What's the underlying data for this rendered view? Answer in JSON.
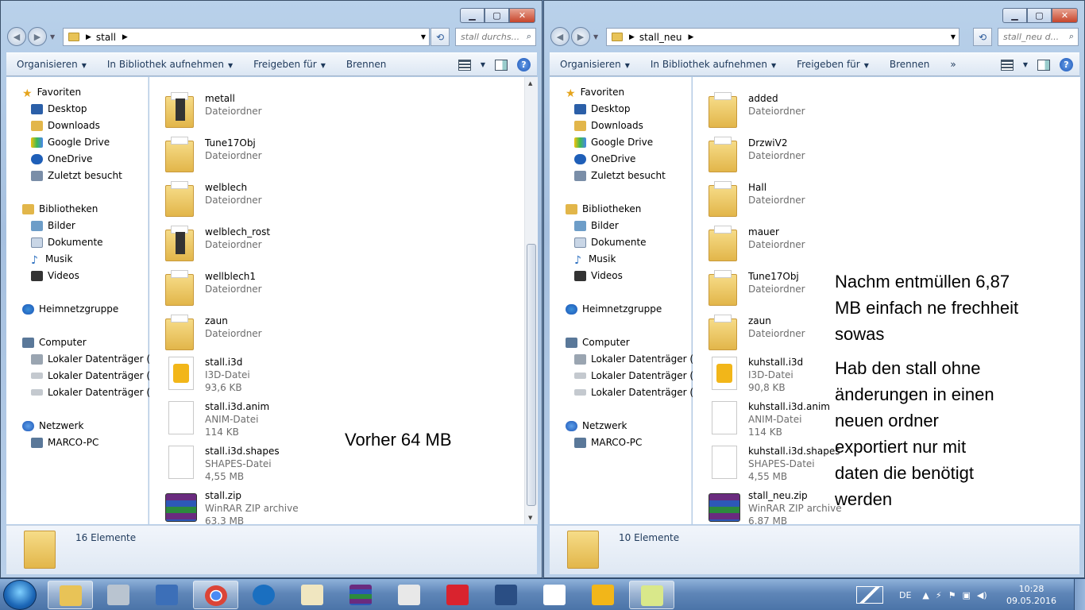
{
  "left": {
    "address_crumb": "stall",
    "search_placeholder": "stall durchs...",
    "toolbar": {
      "organize": "Organisieren",
      "library": "In Bibliothek aufnehmen",
      "share": "Freigeben für",
      "burn": "Brennen"
    },
    "status_count": "16 Elemente",
    "files": [
      {
        "name": "metall",
        "type": "Dateiordner",
        "size": "",
        "icon": "folder-dark-icon"
      },
      {
        "name": "Tune17Obj",
        "type": "Dateiordner",
        "size": "",
        "icon": "folder-icon"
      },
      {
        "name": "welblech",
        "type": "Dateiordner",
        "size": "",
        "icon": "folder-icon"
      },
      {
        "name": "welblech_rost",
        "type": "Dateiordner",
        "size": "",
        "icon": "folder-dark-icon"
      },
      {
        "name": "wellblech1",
        "type": "Dateiordner",
        "size": "",
        "icon": "folder-icon"
      },
      {
        "name": "zaun",
        "type": "Dateiordner",
        "size": "",
        "icon": "folder-icon"
      },
      {
        "name": "stall.i3d",
        "type": "I3D-Datei",
        "size": "93,6 KB",
        "icon": "i3d-file-icon"
      },
      {
        "name": "stall.i3d.anim",
        "type": "ANIM-Datei",
        "size": "114 KB",
        "icon": "file-icon"
      },
      {
        "name": "stall.i3d.shapes",
        "type": "SHAPES-Datei",
        "size": "4,55 MB",
        "icon": "file-icon"
      },
      {
        "name": "stall.zip",
        "type": "WinRAR ZIP archive",
        "size": "63,3 MB",
        "icon": "winrar-icon"
      }
    ],
    "annotation": "Vorher 64 MB"
  },
  "right": {
    "address_crumb": "stall_neu",
    "search_placeholder": "stall_neu d...",
    "toolbar": {
      "organize": "Organisieren",
      "library": "In Bibliothek aufnehmen",
      "share": "Freigeben für",
      "burn": "Brennen"
    },
    "status_count": "10 Elemente",
    "files": [
      {
        "name": "added",
        "type": "Dateiordner",
        "size": "",
        "icon": "folder-icon"
      },
      {
        "name": "DrzwiV2",
        "type": "Dateiordner",
        "size": "",
        "icon": "folder-icon"
      },
      {
        "name": "Hall",
        "type": "Dateiordner",
        "size": "",
        "icon": "folder-icon"
      },
      {
        "name": "mauer",
        "type": "Dateiordner",
        "size": "",
        "icon": "folder-icon"
      },
      {
        "name": "Tune17Obj",
        "type": "Dateiordner",
        "size": "",
        "icon": "folder-icon"
      },
      {
        "name": "zaun",
        "type": "Dateiordner",
        "size": "",
        "icon": "folder-icon"
      },
      {
        "name": "kuhstall.i3d",
        "type": "I3D-Datei",
        "size": "90,8 KB",
        "icon": "i3d-file-icon"
      },
      {
        "name": "kuhstall.i3d.anim",
        "type": "ANIM-Datei",
        "size": "114 KB",
        "icon": "file-icon"
      },
      {
        "name": "kuhstall.i3d.shapes",
        "type": "SHAPES-Datei",
        "size": "4,55 MB",
        "icon": "file-icon"
      },
      {
        "name": "stall_neu.zip",
        "type": "WinRAR ZIP archive",
        "size": "6,87 MB",
        "icon": "winrar-icon"
      }
    ],
    "annotation1": [
      "Nachm entmüllen 6,87",
      "MB einfach ne frechheit",
      "sowas"
    ],
    "annotation2": [
      "Hab den stall ohne",
      "änderungen in einen",
      "neuen ordner",
      "exportiert nur mit",
      "daten die benötigt",
      "werden"
    ]
  },
  "nav": {
    "favorites": "Favoriten",
    "desktop": "Desktop",
    "downloads": "Downloads",
    "gdrive": "Google Drive",
    "onedrive": "OneDrive",
    "recent": "Zuletzt besucht",
    "libraries": "Bibliotheken",
    "pictures": "Bilder",
    "documents": "Dokumente",
    "music": "Musik",
    "videos": "Videos",
    "homegroup": "Heimnetzgruppe",
    "computer": "Computer",
    "drive_c": "Lokaler Datenträger (C:)",
    "drive_d": "Lokaler Datenträger (D:)",
    "drive_j": "Lokaler Datenträger (J:)",
    "network": "Netzwerk",
    "pc": "MARCO-PC"
  },
  "taskbar": {
    "lang": "DE",
    "time": "10:28",
    "date": "09.05.2016",
    "icons": [
      "explorer-icon",
      "calculator-icon",
      "paint-icon",
      "chrome-icon",
      "ccleaner-icon",
      "notepad-icon",
      "winrar-icon",
      "game-controller-icon",
      "giants-editor-icon",
      "bus-simulator-icon",
      "app-grid-icon",
      "i3d-viewer-icon",
      "sticky-notes-icon"
    ]
  }
}
